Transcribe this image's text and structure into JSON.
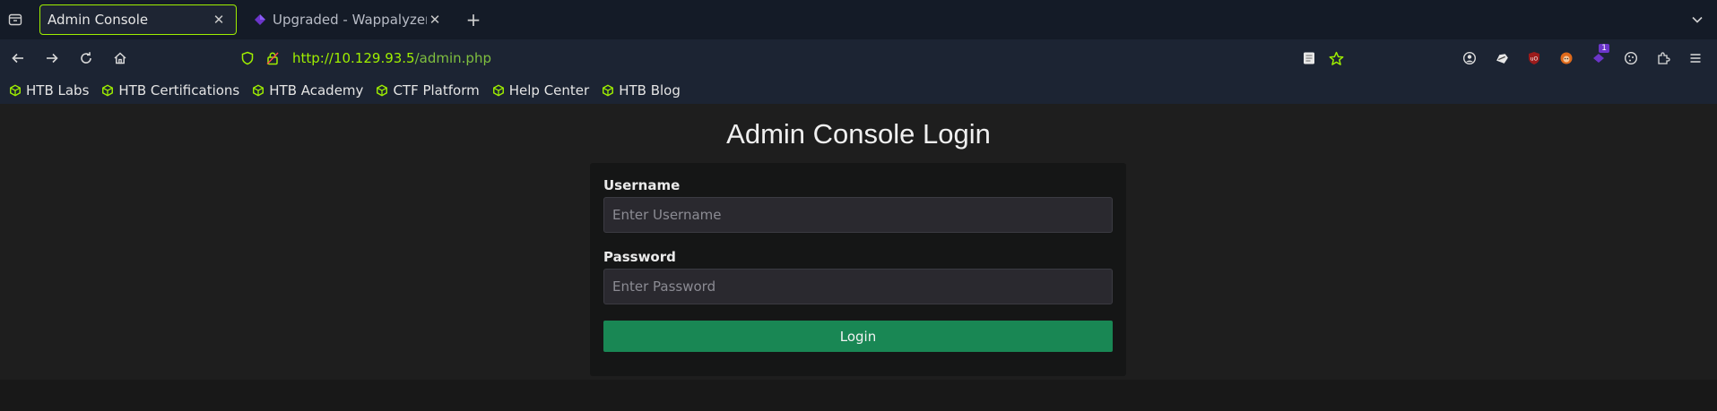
{
  "tabs": [
    {
      "title": "Admin Console",
      "active": true
    },
    {
      "title": "Upgraded - Wappalyzer",
      "active": false
    }
  ],
  "navbar": {
    "url_scheme": "http://",
    "url_host": "10.129.93.5",
    "url_path": "/admin.php"
  },
  "extensions": {
    "badge_count": "1"
  },
  "bookmarks": [
    {
      "label": "HTB Labs"
    },
    {
      "label": "HTB Certifications"
    },
    {
      "label": "HTB Academy"
    },
    {
      "label": "CTF Platform"
    },
    {
      "label": "Help Center"
    },
    {
      "label": "HTB Blog"
    }
  ],
  "page": {
    "title": "Admin Console Login",
    "username_label": "Username",
    "username_placeholder": "Enter Username",
    "password_label": "Password",
    "password_placeholder": "Enter Password",
    "login_label": "Login"
  },
  "colors": {
    "accent": "#9fef00",
    "login_button": "#198754",
    "badge": "#6b35c9"
  }
}
